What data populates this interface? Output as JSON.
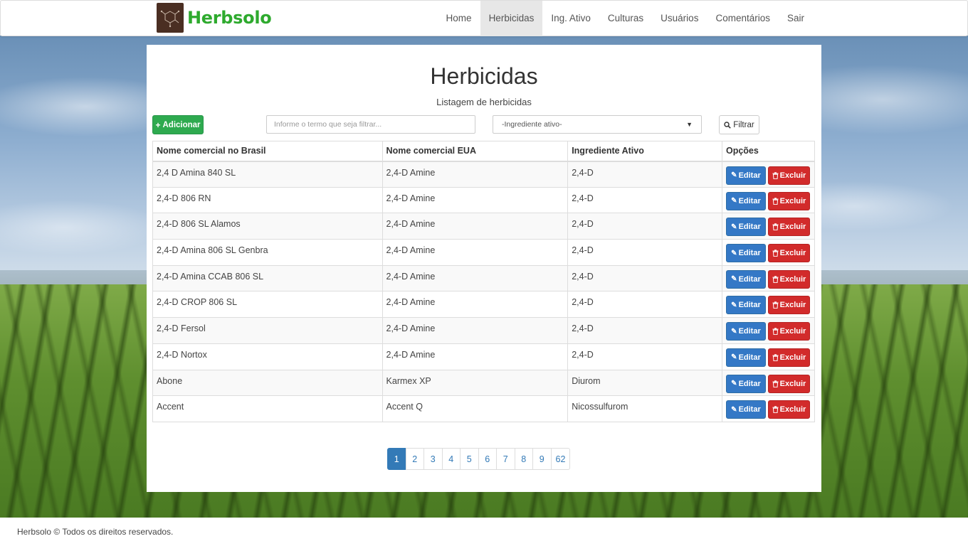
{
  "brand": {
    "name": "Herbsolo"
  },
  "nav": {
    "items": [
      {
        "label": "Home",
        "active": false
      },
      {
        "label": "Herbicidas",
        "active": true
      },
      {
        "label": "Ing. Ativo",
        "active": false
      },
      {
        "label": "Culturas",
        "active": false
      },
      {
        "label": "Usuários",
        "active": false
      },
      {
        "label": "Comentários",
        "active": false
      },
      {
        "label": "Sair",
        "active": false
      }
    ]
  },
  "page": {
    "title": "Herbicidas",
    "subtitle": "Listagem de herbicidas"
  },
  "toolbar": {
    "add_label": "Adicionar",
    "search_placeholder": "Informe o termo que seja filtrar...",
    "select_value": "-Ingrediente ativo-",
    "filter_label": "Filtrar"
  },
  "table": {
    "headers": [
      "Nome comercial no Brasil",
      "Nome comercial EUA",
      "Ingrediente Ativo",
      "Opções"
    ],
    "edit_label": "Editar",
    "delete_label": "Excluir",
    "rows": [
      [
        "2,4 D Amina 840 SL",
        "2,4-D Amine",
        "2,4-D"
      ],
      [
        "2,4-D 806 RN",
        "2,4-D Amine",
        "2,4-D"
      ],
      [
        "2,4-D 806 SL Alamos",
        "2,4-D Amine",
        "2,4-D"
      ],
      [
        "2,4-D Amina 806 SL Genbra",
        "2,4-D Amine",
        "2,4-D"
      ],
      [
        "2,4-D Amina CCAB 806 SL",
        "2,4-D Amine",
        "2,4-D"
      ],
      [
        "2,4-D CROP 806 SL",
        "2,4-D Amine",
        "2,4-D"
      ],
      [
        "2,4-D Fersol",
        "2,4-D Amine",
        "2,4-D"
      ],
      [
        "2,4-D Nortox",
        "2,4-D Amine",
        "2,4-D"
      ],
      [
        "Abone",
        "Karmex XP",
        "Diurom"
      ],
      [
        "Accent",
        "Accent Q",
        "Nicossulfurom"
      ]
    ]
  },
  "pagination": {
    "pages": [
      "1",
      "2",
      "3",
      "4",
      "5",
      "6",
      "7",
      "8",
      "9",
      "62"
    ],
    "active": "1"
  },
  "footer": {
    "text": "Herbsolo © Todos os direitos reservados."
  },
  "colors": {
    "brand_green": "#2eaa2e",
    "add_green": "#2eaa4f",
    "primary_blue": "#337ab7",
    "danger_red": "#d22b2b"
  },
  "icons": {
    "add": "plus-icon",
    "filter": "search-icon",
    "edit": "pencil-icon",
    "delete": "trash-icon",
    "select": "caret-down-icon"
  }
}
